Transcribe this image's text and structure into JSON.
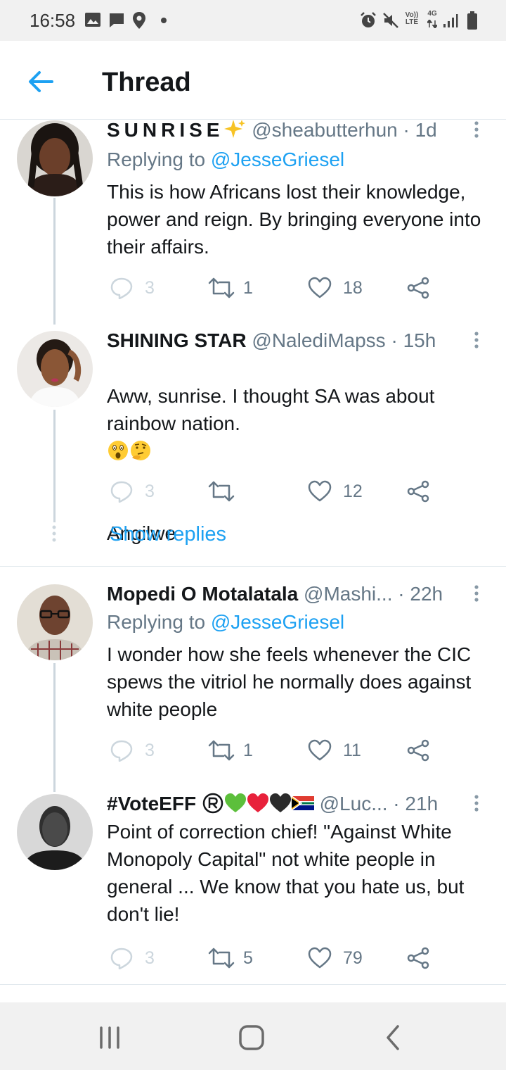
{
  "status_bar": {
    "time": "16:58",
    "left_icons": [
      "image-icon",
      "message-icon",
      "location-icon",
      "dot-icon"
    ],
    "right_icons": [
      "alarm-icon",
      "mute-icon",
      "volte-icon",
      "network-4g-icon",
      "signal-icon",
      "battery-icon"
    ],
    "volte_label": "Vo)) LTE",
    "network_label": "4G"
  },
  "header": {
    "title": "Thread",
    "back_icon": "arrow-left-icon"
  },
  "accent_color": "#1da1f2",
  "tweets": [
    {
      "name": "SUNRISE",
      "name_emoji": "sparkles",
      "handle": "@sheabutterhun",
      "sep": " · ",
      "time": "1d",
      "reply_prefix": "Replying to ",
      "reply_to": "@JesseGriesel",
      "text": "This is how Africans lost their knowledge, power and reign. By bringing everyone into their affairs.",
      "replies": "3",
      "retweets": "1",
      "likes": "18"
    },
    {
      "name": "SHINING STAR",
      "handle": "@NalediMapss",
      "sep": " · ",
      "time": "15h",
      "text": "Aww, sunrise. I thought SA was about rainbow nation.",
      "text_emojis": [
        "astonished-face",
        "thinking-face"
      ],
      "text2": "Angilwe",
      "replies": "3",
      "retweets": "",
      "likes": "12",
      "show_replies": "Show replies"
    },
    {
      "name": "Mopedi O Motalatala",
      "handle": "@Mashi...",
      "sep": " · ",
      "time": "22h",
      "reply_prefix": "Replying to ",
      "reply_to": "@JesseGriesel",
      "text": "I wonder how she feels whenever the CIC spews the vitriol he normally does against white people",
      "replies": "3",
      "retweets": "1",
      "likes": "11"
    },
    {
      "name": "#VoteEFF",
      "name_emojis": [
        "registered",
        "green-heart",
        "red-heart",
        "black-heart",
        "south-africa-flag"
      ],
      "handle": "@Luc...",
      "sep": " · ",
      "time": "21h",
      "text": "Point of correction chief! \"Against White Monopoly Capital\" not white people in general ... We know that you hate us, but don't lie!",
      "replies": "3",
      "retweets": "5",
      "likes": "79"
    }
  ],
  "nav_bar": {
    "icons": [
      "recent-apps-icon",
      "home-icon",
      "back-icon"
    ]
  }
}
